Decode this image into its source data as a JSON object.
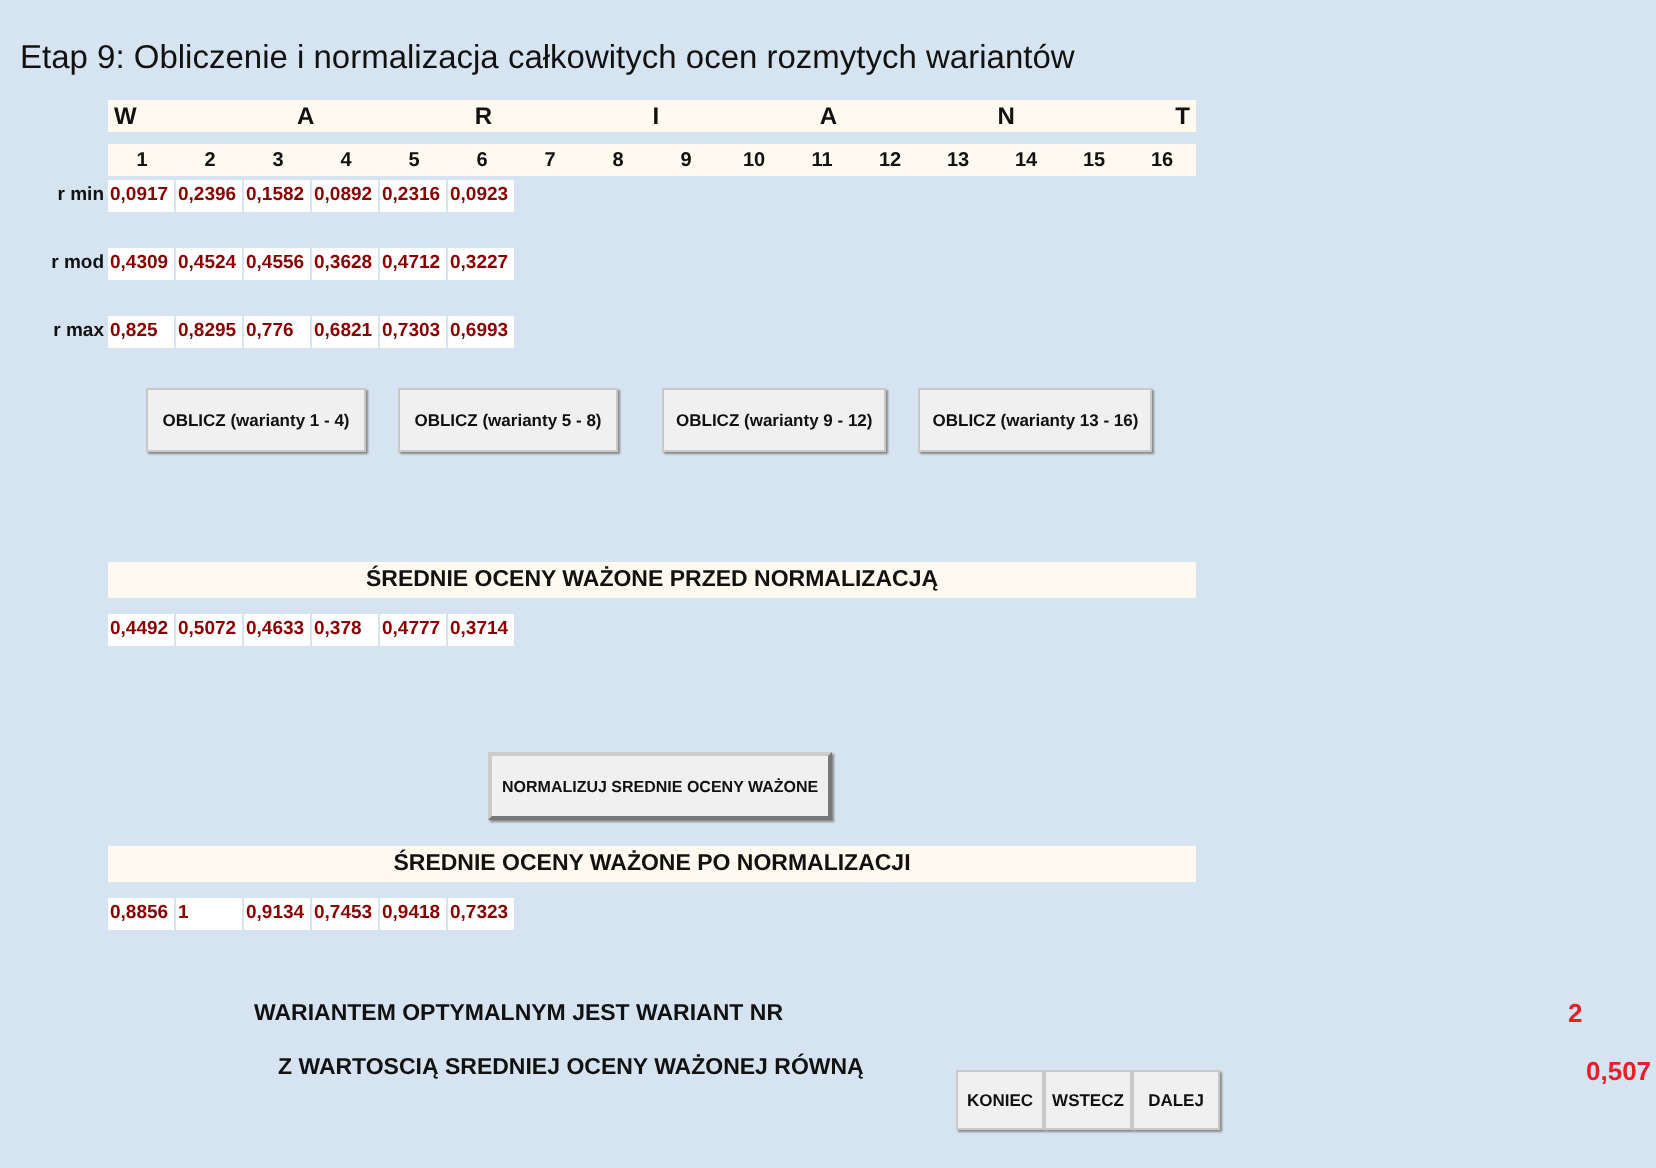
{
  "title": "Etap 9: Obliczenie i normalizacja całkowitych ocen rozmytych wariantów",
  "header_letters": [
    "W",
    "A",
    "R",
    "I",
    "A",
    "N",
    "T"
  ],
  "column_numbers": [
    "1",
    "2",
    "3",
    "4",
    "5",
    "6",
    "7",
    "8",
    "9",
    "10",
    "11",
    "12",
    "13",
    "14",
    "15",
    "16"
  ],
  "rows": [
    {
      "label": "r min",
      "values": [
        "0,0917",
        "0,2396",
        "0,1582",
        "0,0892",
        "0,2316",
        "0,0923"
      ]
    },
    {
      "label": "r mod",
      "values": [
        "0,4309",
        "0,4524",
        "0,4556",
        "0,3628",
        "0,4712",
        "0,3227"
      ]
    },
    {
      "label": "r max",
      "values": [
        "0,825",
        "0,8295",
        "0,776",
        "0,6821",
        "0,7303",
        "0,6993"
      ]
    }
  ],
  "calc_buttons": [
    "OBLICZ (warianty 1 - 4)",
    "OBLICZ (warianty 5 - 8)",
    "OBLICZ (warianty 9 - 12)",
    "OBLICZ (warianty 13 - 16)"
  ],
  "before": {
    "heading": "ŚREDNIE OCENY WAŻONE PRZED NORMALIZACJĄ",
    "values": [
      "0,4492",
      "0,5072",
      "0,4633",
      "0,378",
      "0,4777",
      "0,3714"
    ]
  },
  "normalize_button": "NORMALIZUJ SREDNIE OCENY WAŻONE",
  "after": {
    "heading": "ŚREDNIE OCENY WAŻONE PO NORMALIZACJI",
    "values": [
      "0,8856",
      "1",
      "0,9134",
      "0,7453",
      "0,9418",
      "0,7323"
    ]
  },
  "optimal": {
    "label": "WARIANTEM OPTYMALNYM JEST WARIANT NR",
    "value": "2"
  },
  "optimal_value": {
    "label": "Z WARTOSCIĄ SREDNIEJ OCENY WAŻONEJ RÓWNĄ",
    "value": "0,507"
  },
  "nav_buttons": [
    "KONIEC",
    "WSTECZ",
    "DALEJ"
  ]
}
